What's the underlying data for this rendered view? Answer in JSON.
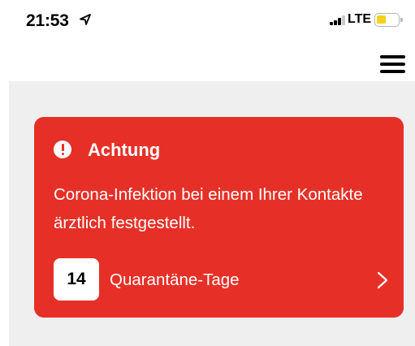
{
  "status_bar": {
    "time": "21:53",
    "network": "LTE",
    "location_icon": "location-arrow-icon",
    "signal_icon": "cellular-signal-icon",
    "battery_icon": "battery-low-icon",
    "battery_color": "#f6d21a"
  },
  "header": {
    "menu_icon": "hamburger-menu-icon"
  },
  "alert": {
    "icon": "exclamation-circle-icon",
    "title": "Achtung",
    "message": "Corona-Infektion bei einem Ihrer Kontakte ärztlich festgestellt.",
    "days": "14",
    "days_label": "Quarantäne-Tage",
    "chevron_icon": "chevron-right-icon",
    "color": "#e63027"
  }
}
